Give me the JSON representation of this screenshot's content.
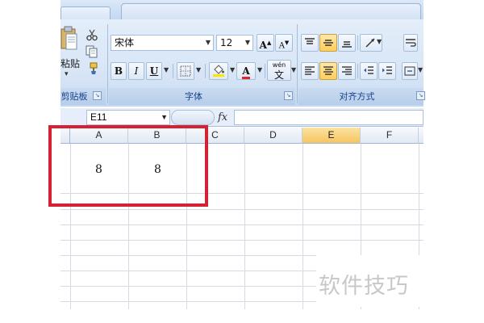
{
  "clipboard": {
    "paste_label": "粘贴",
    "group_label": "剪贴板"
  },
  "font": {
    "font_name": "宋体",
    "font_size": "12",
    "grow_label": "A",
    "shrink_label": "A",
    "bold_label": "B",
    "italic_label": "I",
    "underline_label": "U",
    "font_color_label": "A",
    "phonetic_top": "wén",
    "phonetic_label": "文",
    "group_label": "字体"
  },
  "alignment": {
    "group_label": "对齐方式"
  },
  "formula_bar": {
    "name_box": "E11",
    "fx_label": "fx",
    "formula_value": ""
  },
  "sheet": {
    "columns": [
      "A",
      "B",
      "C",
      "D",
      "E",
      "F"
    ],
    "selected_column": "E",
    "cells": [
      {
        "ref": "A1",
        "value": "8"
      },
      {
        "ref": "B1",
        "value": "8"
      }
    ]
  },
  "watermark": "软件技巧",
  "colors": {
    "highlight": "#d42233",
    "selected_header": "#f6c45f",
    "ribbon_text": "#15428b"
  }
}
